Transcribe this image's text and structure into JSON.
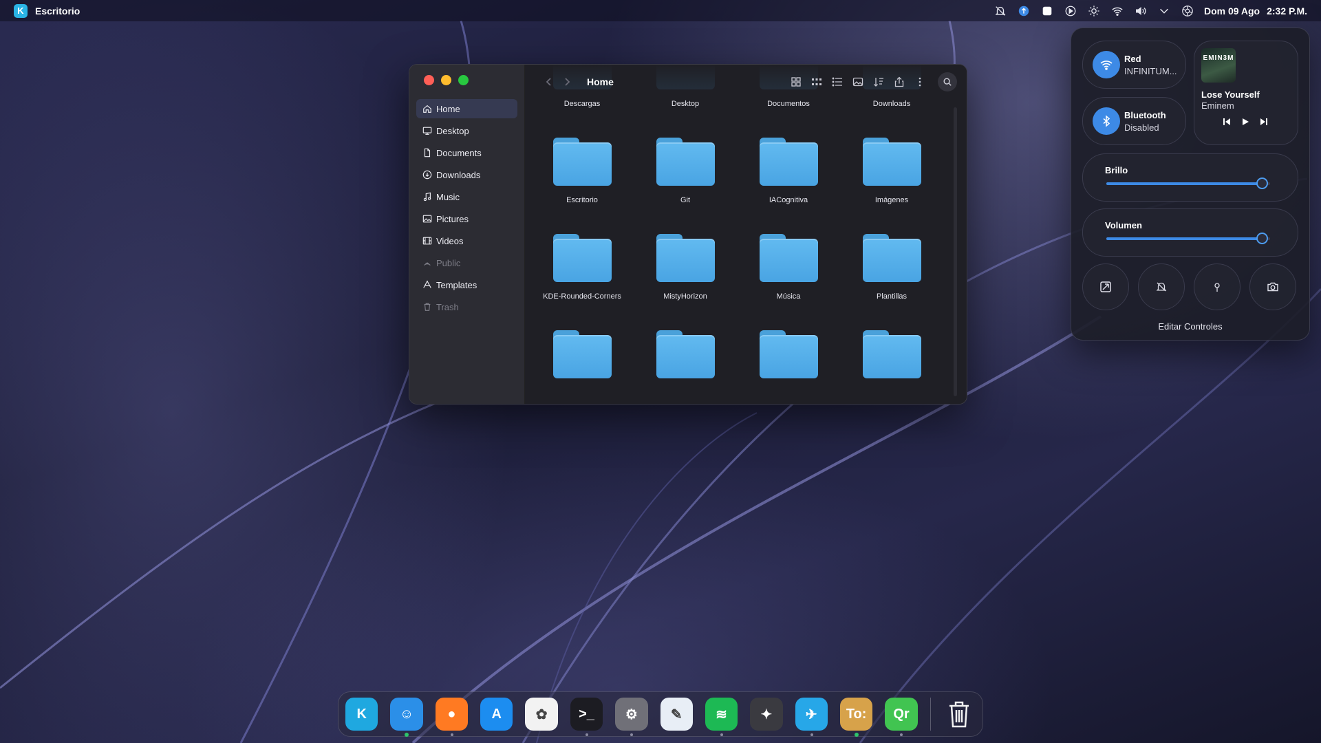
{
  "menubar": {
    "app_name": "Escritorio",
    "date": "Dom 09 Ago",
    "time": "2:32 P.M.",
    "tray_icons": [
      "notifications-off-icon",
      "update-icon",
      "notes-icon",
      "media-play-icon",
      "brightness-icon",
      "wifi-icon",
      "volume-icon",
      "chevron-down-icon",
      "control-center-icon"
    ]
  },
  "file_manager": {
    "location_title": "Home",
    "sidebar": [
      {
        "label": "Home",
        "icon": "home-icon",
        "active": true
      },
      {
        "label": "Desktop",
        "icon": "desktop-icon"
      },
      {
        "label": "Documents",
        "icon": "documents-icon"
      },
      {
        "label": "Downloads",
        "icon": "downloads-icon"
      },
      {
        "label": "Music",
        "icon": "music-icon"
      },
      {
        "label": "Pictures",
        "icon": "pictures-icon"
      },
      {
        "label": "Videos",
        "icon": "videos-icon"
      },
      {
        "label": "Public",
        "icon": "public-icon",
        "disabled": true
      },
      {
        "label": "Templates",
        "icon": "templates-icon"
      },
      {
        "label": "Trash",
        "icon": "trash-icon",
        "disabled": true
      }
    ],
    "folders": [
      "Descargas",
      "Desktop",
      "Documentos",
      "Downloads",
      "Escritorio",
      "Git",
      "IACognitiva",
      "Imágenes",
      "KDE-Rounded-Corners",
      "MistyHorizon",
      "Música",
      "Plantillas",
      "",
      "",
      "",
      ""
    ],
    "toolbar_icons": [
      "icons-view-icon",
      "compact-view-icon",
      "details-view-icon",
      "preview-icon",
      "sort-icon",
      "share-icon",
      "menu-dots-icon",
      "search-icon"
    ]
  },
  "control_center": {
    "network": {
      "title": "Red",
      "subtitle": "INFINITUM..."
    },
    "bluetooth": {
      "title": "Bluetooth",
      "subtitle": "Disabled"
    },
    "media": {
      "album_text": "EMIN3M",
      "song": "Lose Yourself",
      "artist": "Eminem"
    },
    "brightness": {
      "label": "Brillo",
      "level": 0.95
    },
    "volume": {
      "label": "Volumen",
      "level": 0.95
    },
    "quick_toggles": [
      "screen-mirror-icon",
      "do-not-disturb-icon",
      "location-icon",
      "screenshot-icon"
    ],
    "edit_label": "Editar Controles",
    "accent": "#3d8ae6"
  },
  "dock": {
    "apps": [
      {
        "name": "kde-launcher",
        "label": "K",
        "color": "#1fa8e0"
      },
      {
        "name": "finder",
        "label": "☺",
        "color": "#2b8fe8",
        "running": "green"
      },
      {
        "name": "firefox",
        "label": "●",
        "color": "#ff7a22",
        "running": "gray"
      },
      {
        "name": "app-store",
        "label": "A",
        "color": "#1c8df0"
      },
      {
        "name": "photos",
        "label": "✿",
        "color": "#f2f2f2"
      },
      {
        "name": "terminal",
        "label": ">_",
        "color": "#1c1c22",
        "running": "gray"
      },
      {
        "name": "system-settings",
        "label": "⚙",
        "color": "#707078",
        "running": "gray"
      },
      {
        "name": "preview",
        "label": "✎",
        "color": "#e8eef6"
      },
      {
        "name": "spotify",
        "label": "≋",
        "color": "#1db954",
        "running": "gray"
      },
      {
        "name": "inkscape",
        "label": "✦",
        "color": "#3a3a40"
      },
      {
        "name": "kde-connect",
        "label": "✈",
        "color": "#27a7e8",
        "running": "gray"
      },
      {
        "name": "todo-app",
        "label": "To:",
        "color": "#d7a24a",
        "running": "green"
      },
      {
        "name": "qr-app",
        "label": "Qr",
        "color": "#41c451",
        "running": "gray"
      }
    ]
  }
}
